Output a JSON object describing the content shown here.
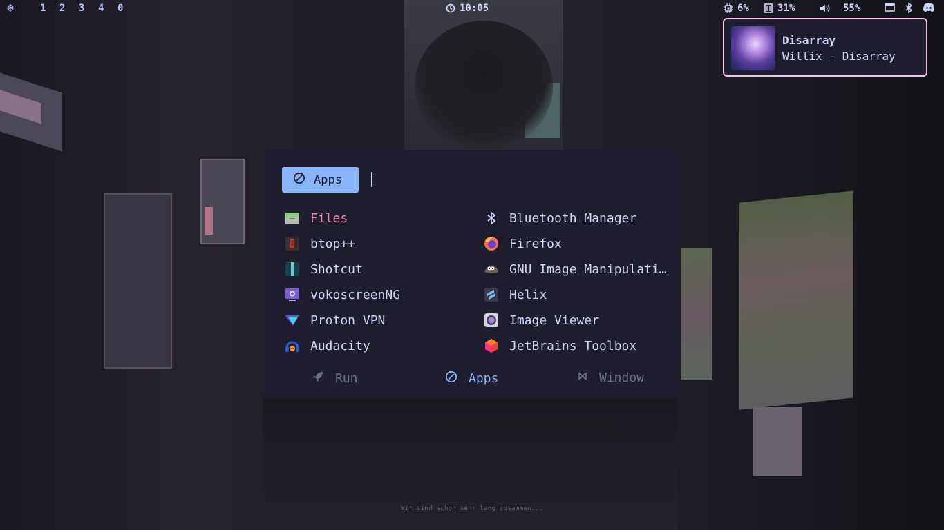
{
  "topbar": {
    "workspaces": [
      "1",
      "2",
      "3",
      "4",
      "0"
    ],
    "clock": "10:05",
    "cpu": "6%",
    "memory": "31%",
    "volume": "55%",
    "icons": [
      "nixos-logo-icon",
      "clock-icon",
      "cpu-icon",
      "memory-icon",
      "volume-icon",
      "window-icon",
      "bluetooth-icon",
      "discord-icon"
    ]
  },
  "notification": {
    "title": "Disarray",
    "body": "Willix - Disarray"
  },
  "launcher": {
    "mode_label": "Apps",
    "query": "",
    "apps": [
      {
        "label": "Files",
        "icon": "files-icon",
        "selected": true
      },
      {
        "label": "btop++",
        "icon": "btop-icon"
      },
      {
        "label": "Shotcut",
        "icon": "shotcut-icon"
      },
      {
        "label": "vokoscreenNG",
        "icon": "vokoscreen-icon"
      },
      {
        "label": "Proton VPN",
        "icon": "protonvpn-icon"
      },
      {
        "label": "Audacity",
        "icon": "audacity-icon"
      },
      {
        "label": "Bluetooth Manager",
        "icon": "bluetooth-icon"
      },
      {
        "label": "Firefox",
        "icon": "firefox-icon"
      },
      {
        "label": "GNU Image Manipulati…",
        "icon": "gimp-icon"
      },
      {
        "label": "Helix",
        "icon": "helix-icon"
      },
      {
        "label": "Image Viewer",
        "icon": "image-viewer-icon"
      },
      {
        "label": "JetBrains Toolbox",
        "icon": "jetbrains-icon"
      }
    ],
    "modes": [
      {
        "label": "Run",
        "icon": "rocket-icon"
      },
      {
        "label": "Apps",
        "icon": "apps-icon",
        "active": true
      },
      {
        "label": "Window",
        "icon": "window-icon"
      }
    ]
  },
  "wallpaper_note": "Wir sind schon sehr lang zusammen...",
  "colors": {
    "accent": "#89b4fa",
    "selected": "#f38ba8",
    "border": "#f5c2e7",
    "panel": "#1e1e2e"
  }
}
